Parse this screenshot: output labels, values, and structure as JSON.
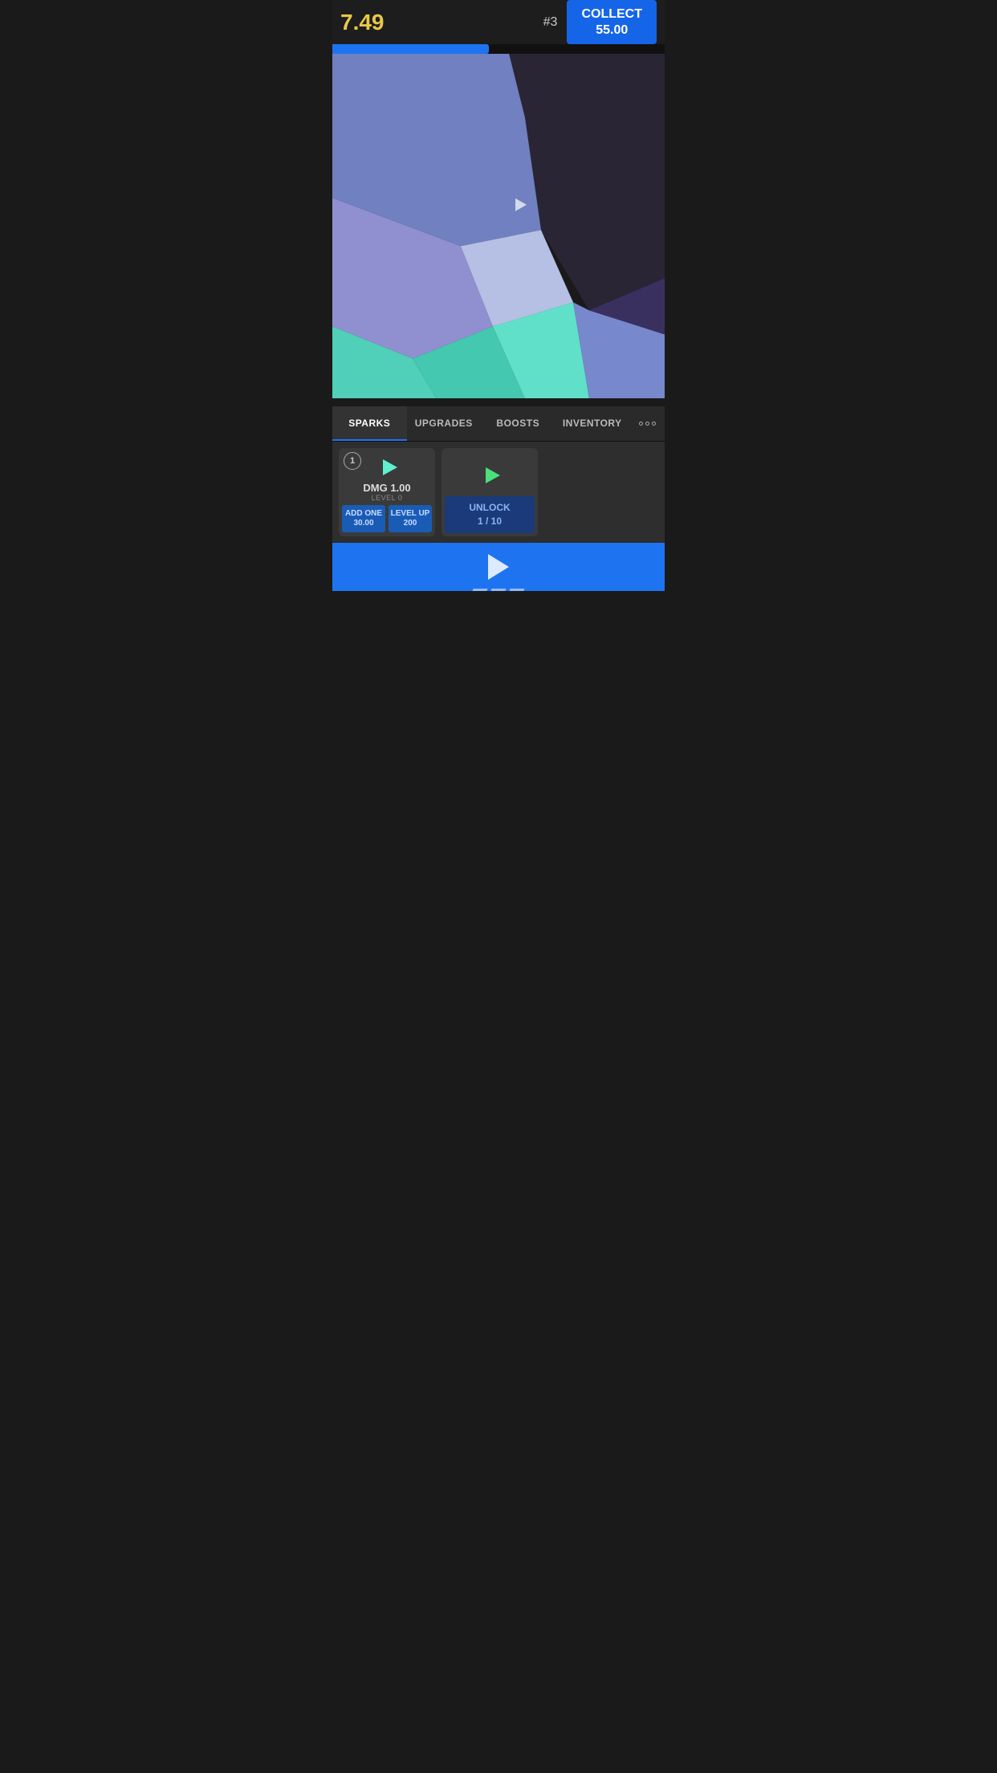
{
  "hud": {
    "score": "7.49",
    "rank": "#3",
    "collect_label": "COLLECT",
    "collect_amount": "55.00",
    "progress_percent": 47
  },
  "tabs": [
    {
      "id": "sparks",
      "label": "SPARKS",
      "active": true
    },
    {
      "id": "upgrades",
      "label": "UPGRADES",
      "active": false
    },
    {
      "id": "boosts",
      "label": "BOOSTS",
      "active": false
    },
    {
      "id": "inventory",
      "label": "INVENTORY",
      "active": false
    }
  ],
  "cards": [
    {
      "number": "1",
      "arrow_color": "cyan",
      "dmg": "DMG 1.00",
      "level": "LEVEL 0",
      "btn1_line1": "ADD ONE",
      "btn1_line2": "30.00",
      "btn2_line1": "LEVEL UP",
      "btn2_line2": "200",
      "type": "unlocked"
    },
    {
      "number": "",
      "arrow_color": "green",
      "dmg": "",
      "level": "",
      "unlock_line1": "UNLOCK",
      "unlock_line2": "1 / 10",
      "type": "locked"
    }
  ],
  "bottom_bar": {
    "label": "tap to fire"
  }
}
